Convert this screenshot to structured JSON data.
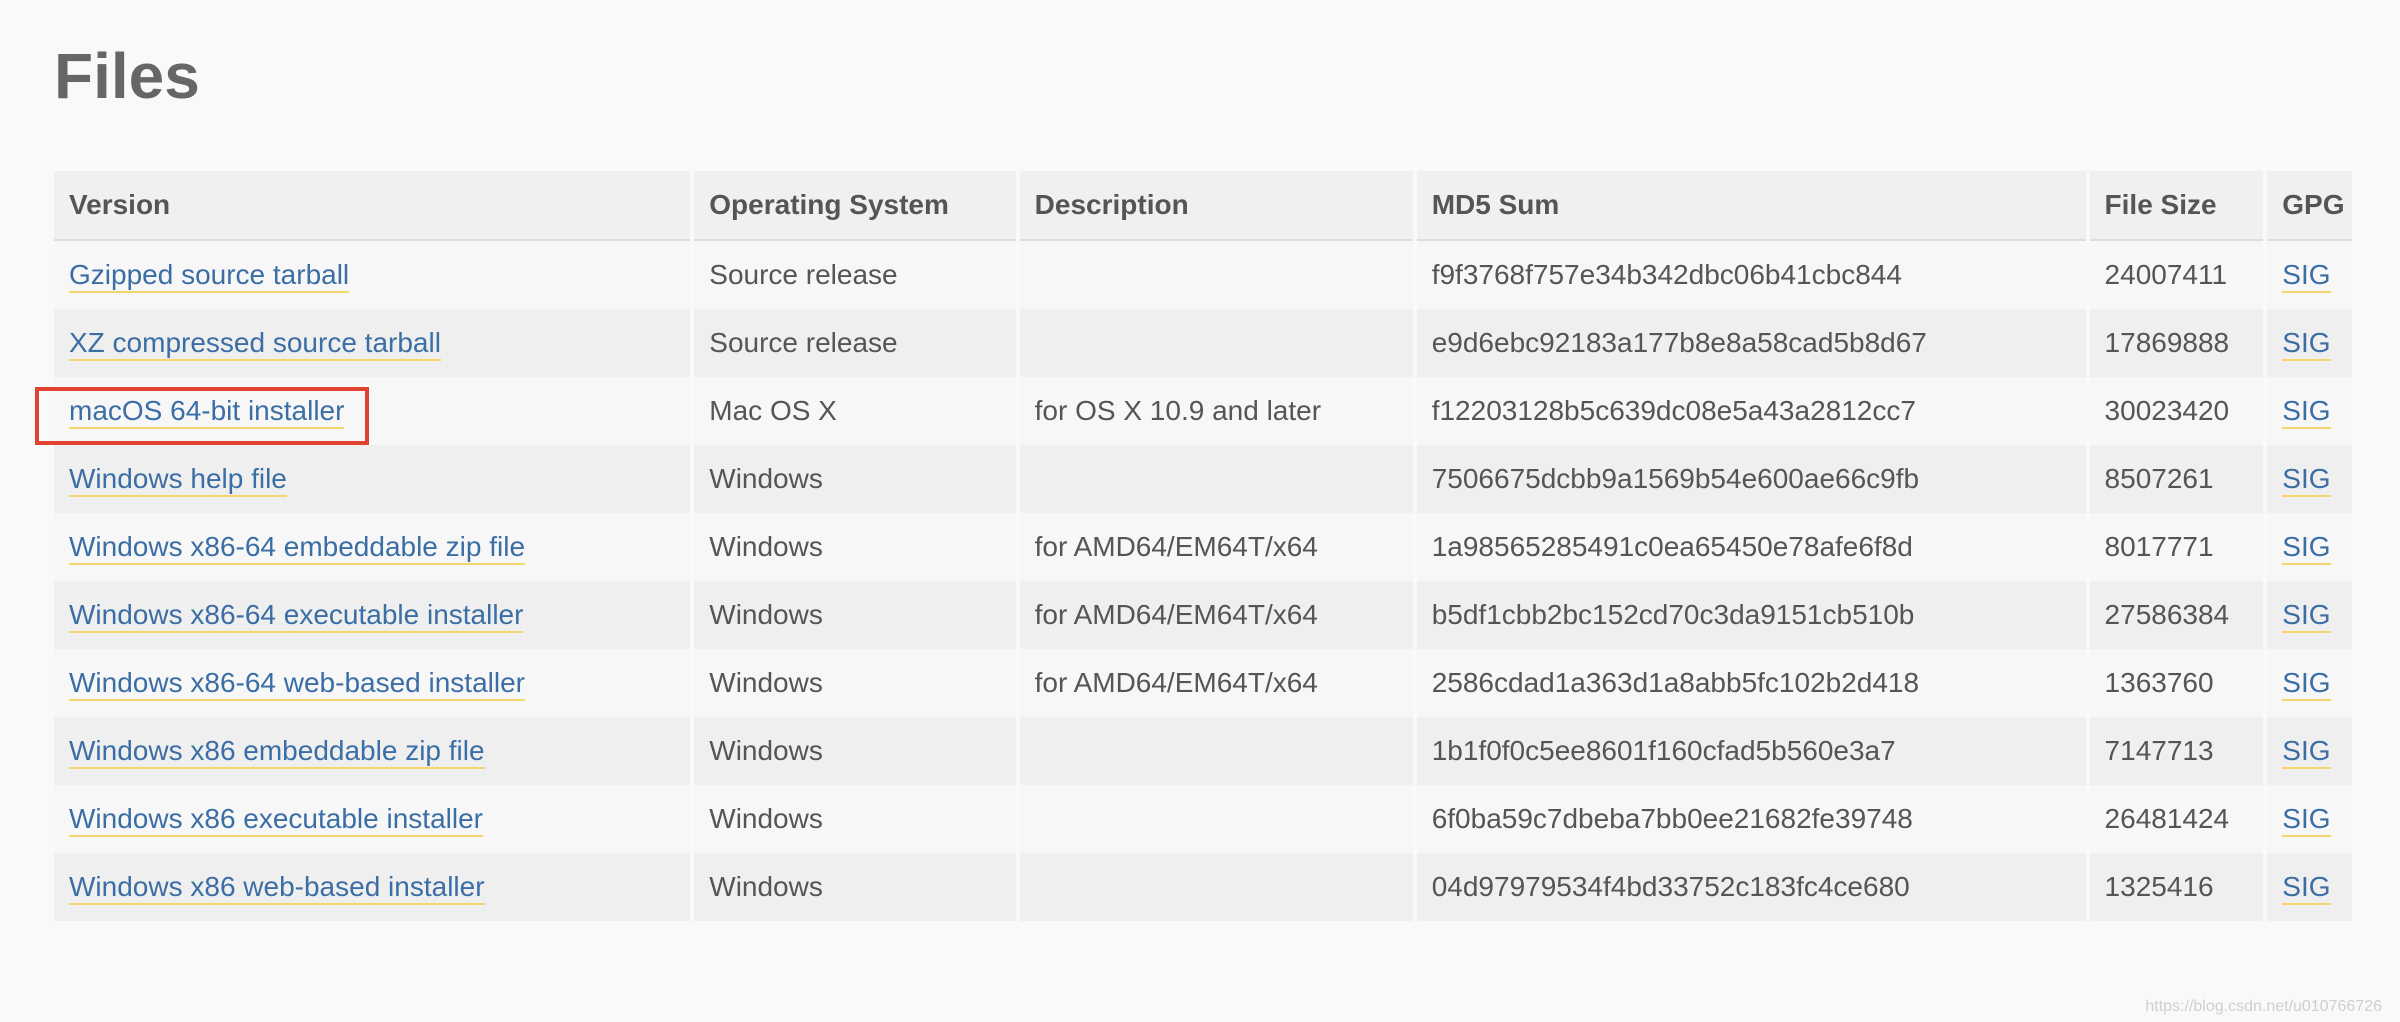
{
  "page": {
    "title": "Files"
  },
  "table": {
    "headers": {
      "version": "Version",
      "os": "Operating System",
      "description": "Description",
      "md5": "MD5 Sum",
      "size": "File Size",
      "gpg": "GPG"
    },
    "rows": [
      {
        "version": "Gzipped source tarball",
        "os": "Source release",
        "description": "",
        "md5": "f9f3768f757e34b342dbc06b41cbc844",
        "size": "24007411",
        "gpg": "SIG"
      },
      {
        "version": "XZ compressed source tarball",
        "os": "Source release",
        "description": "",
        "md5": "e9d6ebc92183a177b8e8a58cad5b8d67",
        "size": "17869888",
        "gpg": "SIG"
      },
      {
        "version": "macOS 64-bit installer",
        "os": "Mac OS X",
        "description": "for OS X 10.9 and later",
        "md5": "f12203128b5c639dc08e5a43a2812cc7",
        "size": "30023420",
        "gpg": "SIG"
      },
      {
        "version": "Windows help file",
        "os": "Windows",
        "description": "",
        "md5": "7506675dcbb9a1569b54e600ae66c9fb",
        "size": "8507261",
        "gpg": "SIG"
      },
      {
        "version": "Windows x86-64 embeddable zip file",
        "os": "Windows",
        "description": "for AMD64/EM64T/x64",
        "md5": "1a98565285491c0ea65450e78afe6f8d",
        "size": "8017771",
        "gpg": "SIG"
      },
      {
        "version": "Windows x86-64 executable installer",
        "os": "Windows",
        "description": "for AMD64/EM64T/x64",
        "md5": "b5df1cbb2bc152cd70c3da9151cb510b",
        "size": "27586384",
        "gpg": "SIG"
      },
      {
        "version": "Windows x86-64 web-based installer",
        "os": "Windows",
        "description": "for AMD64/EM64T/x64",
        "md5": "2586cdad1a363d1a8abb5fc102b2d418",
        "size": "1363760",
        "gpg": "SIG"
      },
      {
        "version": "Windows x86 embeddable zip file",
        "os": "Windows",
        "description": "",
        "md5": "1b1f0f0c5ee8601f160cfad5b560e3a7",
        "size": "7147713",
        "gpg": "SIG"
      },
      {
        "version": "Windows x86 executable installer",
        "os": "Windows",
        "description": "",
        "md5": "6f0ba59c7dbeba7bb0ee21682fe39748",
        "size": "26481424",
        "gpg": "SIG"
      },
      {
        "version": "Windows x86 web-based installer",
        "os": "Windows",
        "description": "",
        "md5": "04d97979534f4bd33752c183fc4ce680",
        "size": "1325416",
        "gpg": "SIG"
      }
    ]
  },
  "annotation": {
    "highlight_color": "#e0432f"
  },
  "colors": {
    "link": "#3b6ea5",
    "link_underline": "#f5d66a",
    "title": "#666666",
    "background": "#f9f9f9"
  },
  "watermark": {
    "text": "https://blog.csdn.net/u010766726"
  }
}
